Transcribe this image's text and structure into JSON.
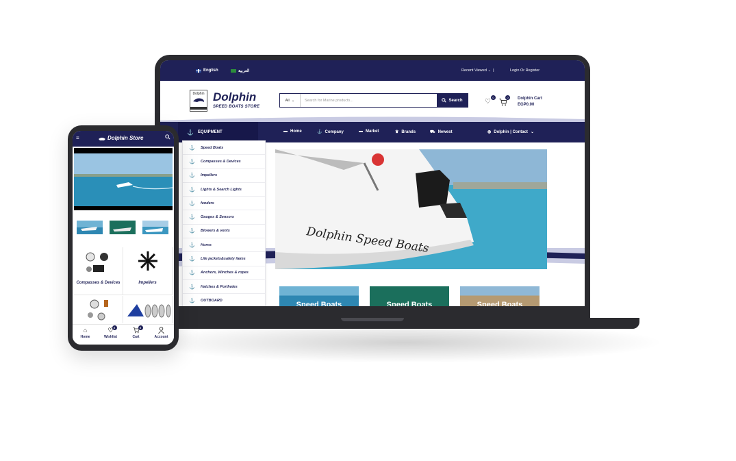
{
  "laptop": {
    "topbar": {
      "lang_en": "English",
      "lang_ar": "العربية",
      "recent_viewed": "Recent Viewed",
      "login": "Login Or Register"
    },
    "header": {
      "logo_badge": "Dolphin",
      "logo_title": "Dolphin",
      "logo_sub": "SPEED BOATS STORE",
      "search_category": "All",
      "search_placeholder": "Search for Marine products...",
      "search_button": "Search",
      "wishlist_count": "0",
      "cart_count": "0",
      "cart_label": "Dolphin Cart",
      "cart_total": "EGP0.00"
    },
    "nav": {
      "category_label": "EQUIPMENT",
      "items": [
        "Home",
        "Company",
        "Market",
        "Brands",
        "Newest"
      ],
      "contact": "Dolphin | Contact"
    },
    "menu": [
      "Speed Boats",
      "Compasses & Devices",
      "Impellers",
      "Lights & Search Lights",
      "fenders",
      "Gauges & Sensors",
      "Blowers & vents",
      "Horns",
      "Life jackets&safety items",
      "Anchors, Winches & ropes",
      "Hatches & Portholes",
      "OUTBOARD"
    ],
    "hero": {
      "boat_text": "Dolphin Speed Boats"
    },
    "thumbs": [
      "Speed Boats",
      "Speed Boats",
      "Speed Boats"
    ]
  },
  "phone": {
    "title": "Dolphin Store",
    "categories": [
      "Compasses & Devices",
      "Impellers"
    ],
    "bottom_nav": [
      "Home",
      "Wishlist",
      "Cart",
      "Account"
    ],
    "wishlist_count": "0",
    "cart_count": "0"
  },
  "colors": {
    "navy": "#1f2157",
    "dark_frame": "#2b2b2f",
    "sea": "#3fa9c9"
  }
}
